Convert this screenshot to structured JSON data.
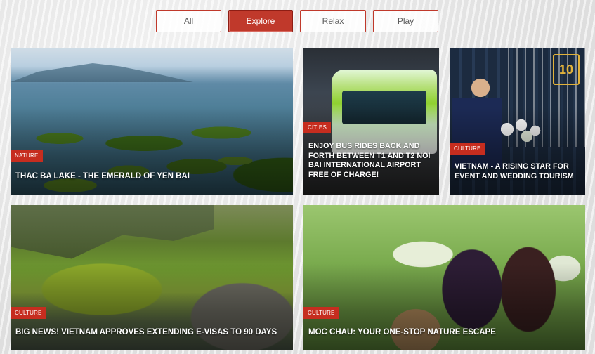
{
  "filters": {
    "tabs": [
      {
        "label": "All",
        "active": false
      },
      {
        "label": "Explore",
        "active": true
      },
      {
        "label": "Relax",
        "active": false
      },
      {
        "label": "Play",
        "active": false
      }
    ],
    "active_color": "#c0392b"
  },
  "cards": [
    {
      "category": "NATURE",
      "title": "THAC BA LAKE - THE EMERALD OF YEN BAI"
    },
    {
      "category": "CITIES",
      "title": "ENJOY BUS RIDES BACK AND FORTH BETWEEN T1 AND T2 NOI BAI INTERNATIONAL AIRPORT FREE OF CHARGE!"
    },
    {
      "category": "CULTURE",
      "title": "VIETNAM - A RISING STAR FOR EVENT AND WEDDING TOURISM"
    },
    {
      "category": "CULTURE",
      "title": "BIG NEWS! VIETNAM APPROVES EXTENDING E-VISAS TO 90 DAYS"
    },
    {
      "category": "CULTURE",
      "title": "MOC CHAU: YOUR ONE-STOP NATURE ESCAPE"
    }
  ],
  "card3_logo_text": "10",
  "badge_color": "#c62d1f"
}
